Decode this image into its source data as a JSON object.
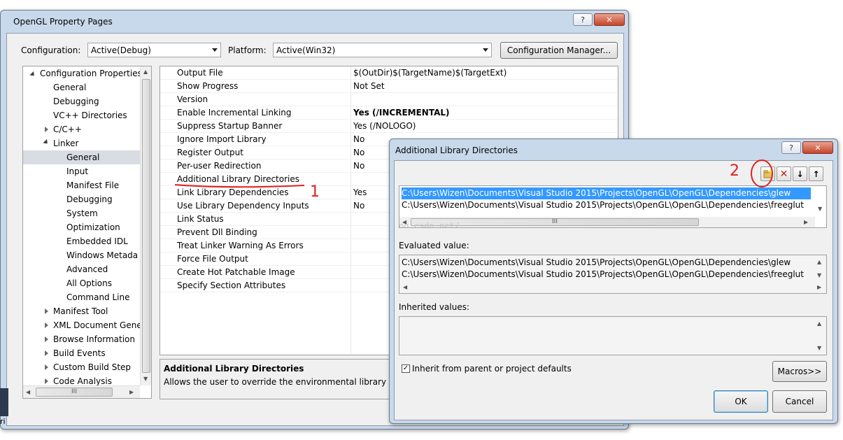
{
  "main_window": {
    "title": "OpenGL Property Pages",
    "help_btn": "?",
    "close_btn": "✕",
    "configuration_label": "Configuration:",
    "configuration_value": "Active(Debug)",
    "platform_label": "Platform:",
    "platform_value": "Active(Win32)",
    "config_manager_btn": "Configuration Manager..."
  },
  "tree": {
    "root": "Configuration Properties",
    "items": [
      {
        "label": "General"
      },
      {
        "label": "Debugging"
      },
      {
        "label": "VC++ Directories"
      },
      {
        "label": "C/C++"
      },
      {
        "label": "Linker"
      },
      {
        "label": "General"
      },
      {
        "label": "Input"
      },
      {
        "label": "Manifest File"
      },
      {
        "label": "Debugging"
      },
      {
        "label": "System"
      },
      {
        "label": "Optimization"
      },
      {
        "label": "Embedded IDL"
      },
      {
        "label": "Windows Metada"
      },
      {
        "label": "Advanced"
      },
      {
        "label": "All Options"
      },
      {
        "label": "Command Line"
      },
      {
        "label": "Manifest Tool"
      },
      {
        "label": "XML Document Gene"
      },
      {
        "label": "Browse Information"
      },
      {
        "label": "Build Events"
      },
      {
        "label": "Custom Build Step"
      },
      {
        "label": "Code Analysis"
      }
    ],
    "hscroll_thumb": "III"
  },
  "properties": [
    {
      "name": "Output File",
      "value": "$(OutDir)$(TargetName)$(TargetExt)"
    },
    {
      "name": "Show Progress",
      "value": "Not Set"
    },
    {
      "name": "Version",
      "value": ""
    },
    {
      "name": "Enable Incremental Linking",
      "value": "Yes (/INCREMENTAL)"
    },
    {
      "name": "Suppress Startup Banner",
      "value": "Yes (/NOLOGO)"
    },
    {
      "name": "Ignore Import Library",
      "value": "No"
    },
    {
      "name": "Register Output",
      "value": "No"
    },
    {
      "name": "Per-user Redirection",
      "value": "No"
    },
    {
      "name": "Additional Library Directories",
      "value": ""
    },
    {
      "name": "Link Library Dependencies",
      "value": "Yes"
    },
    {
      "name": "Use Library Dependency Inputs",
      "value": "No"
    },
    {
      "name": "Link Status",
      "value": ""
    },
    {
      "name": "Prevent Dll Binding",
      "value": ""
    },
    {
      "name": "Treat Linker Warning As Errors",
      "value": ""
    },
    {
      "name": "Force File Output",
      "value": ""
    },
    {
      "name": "Create Hot Patchable Image",
      "value": ""
    },
    {
      "name": "Specify Section Attributes",
      "value": ""
    }
  ],
  "description": {
    "title": "Additional Library Directories",
    "text": "Allows the user to override the environmental library pa"
  },
  "dialog": {
    "title": "Additional Library Directories",
    "help_btn": "?",
    "close_btn": "✕",
    "entries": [
      "C:\\Users\\Wizen\\Documents\\Visual Studio 2015\\Projects\\OpenGL\\OpenGL\\Dependencies\\glew",
      "C:\\Users\\Wizen\\Documents\\Visual Studio 2015\\Projects\\OpenGL\\OpenGL\\Dependencies\\freeglut"
    ],
    "hscroll_thumb": "III",
    "watermark": "http://blog.csdn.net/",
    "evaluated_label": "Evaluated value:",
    "evaluated": [
      "C:\\Users\\Wizen\\Documents\\Visual Studio 2015\\Projects\\OpenGL\\OpenGL\\Dependencies\\glew",
      "C:\\Users\\Wizen\\Documents\\Visual Studio 2015\\Projects\\OpenGL\\OpenGL\\Dependencies\\freeglut"
    ],
    "inherited_label": "Inherited values:",
    "inherit_checkbox_label": "Inherit from parent or project defaults",
    "macros_btn": "Macros>>",
    "ok_btn": "OK",
    "cancel_btn": "Cancel"
  },
  "annotations": {
    "one": "1",
    "two": "2",
    "color": "#e02020"
  }
}
